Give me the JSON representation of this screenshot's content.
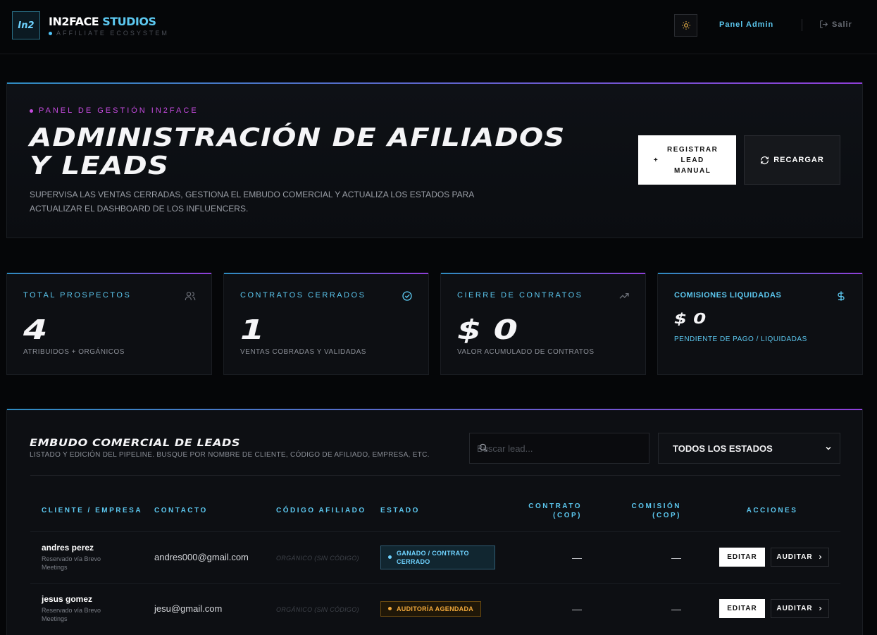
{
  "header": {
    "logo_text": "In2",
    "brand_main": "IN2FACE",
    "brand_accent": "STUDIOS",
    "brand_sub": "AFFILIATE ECOSYSTEM",
    "nav_admin": "Panel Admin",
    "nav_exit": "Salir"
  },
  "hero": {
    "eyebrow": "PANEL DE GESTIÓN IN2FACE",
    "title": "ADMINISTRACIÓN DE AFILIADOS Y LEADS",
    "description": "SUPERVISA LAS VENTAS CERRADAS, GESTIONA EL EMBUDO COMERCIAL Y ACTUALIZA LOS ESTADOS PARA ACTUALIZAR EL DASHBOARD DE LOS INFLUENCERS.",
    "register_label": "REGISTRAR LEAD MANUAL",
    "register_prefix": "+",
    "reload_label": "RECARGAR"
  },
  "stats": [
    {
      "label": "TOTAL PROSPECTOS",
      "value": "4",
      "sub": "ATRIBUIDOS + ORGÁNICOS",
      "icon": "users-icon"
    },
    {
      "label": "CONTRATOS CERRADOS",
      "value": "1",
      "sub": "VENTAS COBRADAS Y VALIDADAS",
      "icon": "check-circle-icon"
    },
    {
      "label": "CIERRE DE CONTRATOS",
      "value": "$ 0",
      "sub": "VALOR ACUMULADO DE CONTRATOS",
      "icon": "trending-up-icon"
    },
    {
      "label": "COMISIONES LIQUIDADAS",
      "value": "$ 0",
      "sub": "PENDIENTE DE PAGO / LIQUIDADAS",
      "icon": "dollar-icon"
    }
  ],
  "funnel": {
    "title": "EMBUDO COMERCIAL DE LEADS",
    "subtitle": "LISTADO Y EDICIÓN DEL PIPELINE. BUSQUE POR NOMBRE DE CLIENTE, CÓDIGO DE AFILIADO, EMPRESA, ETC.",
    "search_placeholder": "Buscar lead...",
    "filter_value": "TODOS LOS ESTADOS",
    "columns": [
      "CLIENTE / EMPRESA",
      "CONTACTO",
      "CÓDIGO AFILIADO",
      "ESTADO",
      "CONTRATO (COP)",
      "COMISIÓN (COP)",
      "ACCIONES"
    ],
    "edit_label": "EDITAR",
    "audit_label": "AUDITAR",
    "rows": [
      {
        "name": "andres perez",
        "source": "Reservado vía Brevo Meetings",
        "email": "andres000@gmail.com",
        "code": "ORGÁNICO (SIN CÓDIGO)",
        "status": "GANADO / CONTRATO CERRADO",
        "contract": "—",
        "commission": "—"
      },
      {
        "name": "jesus gomez",
        "source": "Reservado vía Brevo Meetings",
        "email": "jesu@gmail.com",
        "code": "ORGÁNICO (SIN CÓDIGO)",
        "status": "AUDITORÍA AGENDADA",
        "contract": "—",
        "commission": "—"
      }
    ]
  },
  "colors": {
    "accent": "#5cc8f0",
    "magenta": "#c64be0",
    "warning": "#f2a93b",
    "bg": "#050608"
  }
}
